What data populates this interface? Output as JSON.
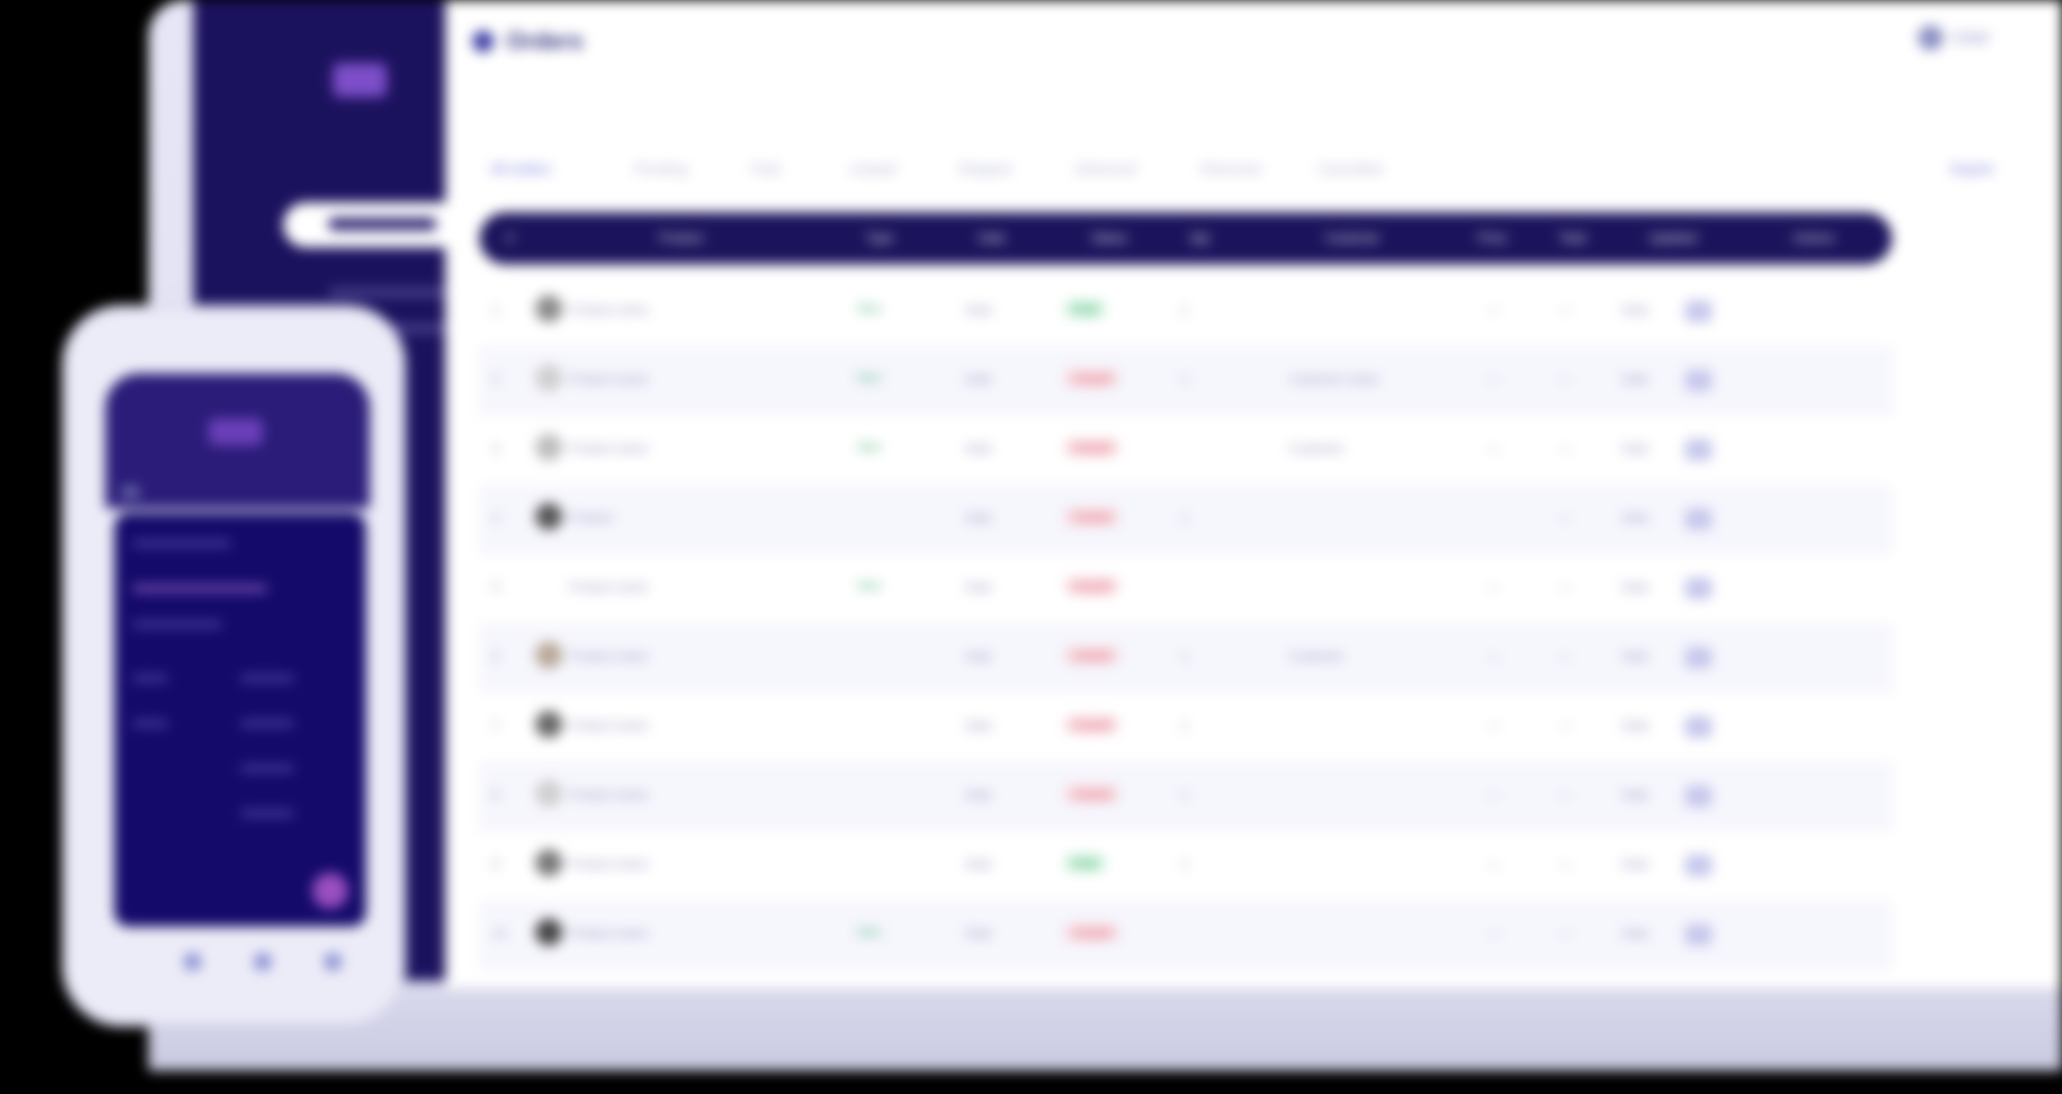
{
  "app": {
    "page_title": "Orders",
    "user_label": "User"
  },
  "filters": {
    "tabs": [
      "All orders",
      "Pending",
      "Paid",
      "Unpaid",
      "Shipped",
      "Delivered",
      "Returned",
      "Cancelled"
    ],
    "active_index": 0,
    "right_action": "Export"
  },
  "table": {
    "columns": [
      "#",
      "Product",
      "Type",
      "Date",
      "Status",
      "Qty",
      "Customer",
      "Price",
      "Total",
      "Updated",
      "Actions"
    ],
    "rows": [
      {
        "num": "1",
        "product": "Product name",
        "type": "New",
        "date": "Date",
        "status": "Paid",
        "status_color": "green",
        "qty": "1",
        "customer": "",
        "price": "—",
        "total": "—",
        "updated": "Date"
      },
      {
        "num": "2",
        "product": "Product name",
        "type": "New",
        "date": "Date",
        "status": "Unpaid",
        "status_color": "red",
        "qty": "1",
        "customer": "Customer name",
        "price": "—",
        "total": "—",
        "updated": "Date"
      },
      {
        "num": "3",
        "product": "Product name",
        "type": "New",
        "date": "Date",
        "status": "Unpaid",
        "status_color": "red",
        "qty": "",
        "customer": "Customer",
        "price": "—",
        "total": "—",
        "updated": "Date"
      },
      {
        "num": "4",
        "product": "Product",
        "type": "",
        "date": "Date",
        "status": "Unpaid",
        "status_color": "red",
        "qty": "1",
        "customer": "",
        "price": "",
        "total": "—",
        "updated": "Date"
      },
      {
        "num": "5",
        "product": "Product name",
        "type": "New",
        "date": "Date",
        "status": "Unpaid",
        "status_color": "red",
        "qty": "",
        "customer": "",
        "price": "—",
        "total": "—",
        "updated": "Date"
      },
      {
        "num": "6",
        "product": "Product name",
        "type": "",
        "date": "Date",
        "status": "Unpaid",
        "status_color": "red",
        "qty": "1",
        "customer": "Customer",
        "price": "—",
        "total": "—",
        "updated": "Date"
      },
      {
        "num": "7",
        "product": "Product name",
        "type": "",
        "date": "Date",
        "status": "Unpaid",
        "status_color": "red",
        "qty": "1",
        "customer": "",
        "price": "—",
        "total": "—",
        "updated": "Date"
      },
      {
        "num": "8",
        "product": "Product name",
        "type": "",
        "date": "Date",
        "status": "Unpaid",
        "status_color": "red",
        "qty": "1",
        "customer": "",
        "price": "—",
        "total": "—",
        "updated": "Date"
      },
      {
        "num": "9",
        "product": "Product name",
        "type": "",
        "date": "Date",
        "status": "Paid",
        "status_color": "green",
        "qty": "1",
        "customer": "",
        "price": "—",
        "total": "—",
        "updated": "Date"
      },
      {
        "num": "10",
        "product": "Product name",
        "type": "New",
        "date": "Date",
        "status": "Unpaid",
        "status_color": "red",
        "qty": "",
        "customer": "",
        "price": "—",
        "total": "—",
        "updated": "Date"
      }
    ]
  },
  "colors": {
    "sidebar": "#1b125e",
    "accent": "#6a6fd6",
    "green": "#2e9c5c",
    "red": "#d94b63"
  },
  "icons": {
    "logo": "brand-logo-icon",
    "page": "orders-icon",
    "action": "edit-icon"
  }
}
